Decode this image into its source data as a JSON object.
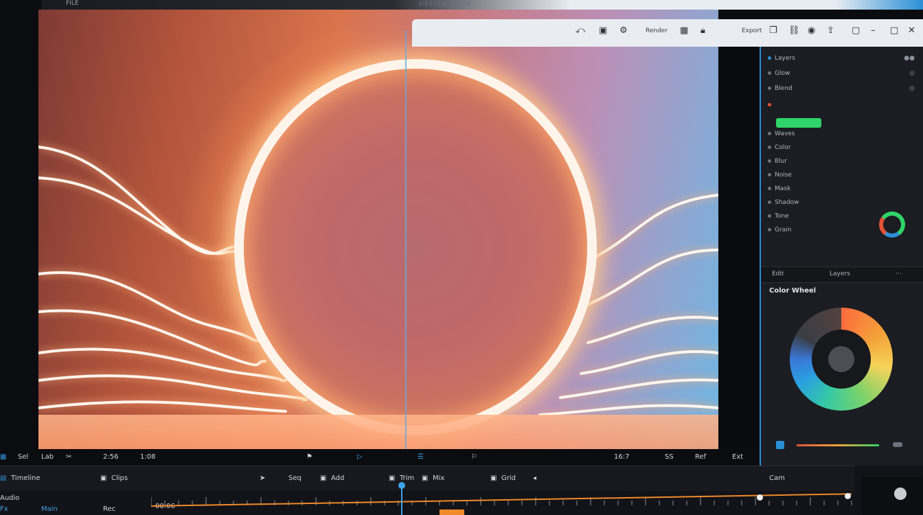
{
  "window": {
    "title": "DESIGN ROOM",
    "left_label": "FILE"
  },
  "toolbar": {
    "icons": [
      "undo-icon",
      "layers-icon",
      "settings-icon"
    ],
    "labels": [
      "Render",
      "Export"
    ]
  },
  "panel": {
    "rows": [
      {
        "label": "Layers",
        "state": "active"
      },
      {
        "label": "Glow",
        "state": "normal"
      },
      {
        "label": "Blend",
        "state": "normal"
      },
      {
        "label": "Waves",
        "state": "red"
      },
      {
        "label": "Color",
        "state": "normal"
      },
      {
        "label": "Blur",
        "state": "normal"
      },
      {
        "label": "Noise",
        "state": "normal"
      },
      {
        "label": "Mask",
        "state": "normal"
      },
      {
        "label": "Shadow",
        "state": "normal"
      },
      {
        "label": "Tone",
        "state": "normal"
      },
      {
        "label": "Grain",
        "state": "normal"
      }
    ],
    "tabs": [
      "Edit",
      "Layers"
    ],
    "color_heading": "Color Wheel",
    "colors": {
      "accent": "#2a8fd6",
      "green": "#2fd46a",
      "red": "#e0533a",
      "orange": "#f08a2a"
    }
  },
  "transport": {
    "left": [
      "Sel",
      "Lab",
      "Cut"
    ],
    "time_a": "2:56",
    "time_b": "1:08",
    "right": [
      "16:7",
      "SS",
      "Ref",
      "Ext"
    ]
  },
  "timeline": {
    "header": [
      "Timeline",
      "Clips",
      "Seq",
      "Add",
      "Trim",
      "Mix",
      "Grid",
      "Cam"
    ],
    "rows": [
      "Audio",
      "Fx",
      "Main"
    ],
    "timecode": "00:06",
    "scrub_label": "Rec",
    "playhead_fraction": 0.36
  }
}
